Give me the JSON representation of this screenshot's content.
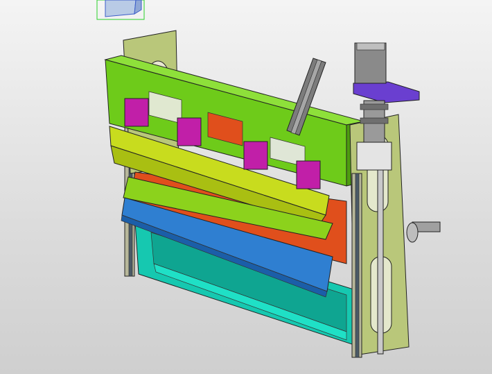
{
  "app": {
    "view": "3d-cad-viewport"
  },
  "model": {
    "parts": [
      {
        "name": "top-beam",
        "color": "#6ecb1a"
      },
      {
        "name": "lower-blade-bar",
        "color": "#c8dc1e"
      },
      {
        "name": "red-roller",
        "color": "#e04f1c"
      },
      {
        "name": "blue-comb",
        "color": "#2f7fd1"
      },
      {
        "name": "teal-frame",
        "color": "#16c8b0"
      },
      {
        "name": "side-plate",
        "color": "#b9c77a"
      },
      {
        "name": "pneumatic-cylinder",
        "color": "#7c7c7c"
      },
      {
        "name": "clamp-blocks",
        "color": "#c11fa8"
      },
      {
        "name": "motor-mount",
        "color": "#6a3fd0"
      },
      {
        "name": "servo-motor",
        "color": "#8a8a8a"
      }
    ]
  },
  "colors": {
    "background_top": "#f4f4f4",
    "background_bottom": "#cfcfcf"
  }
}
